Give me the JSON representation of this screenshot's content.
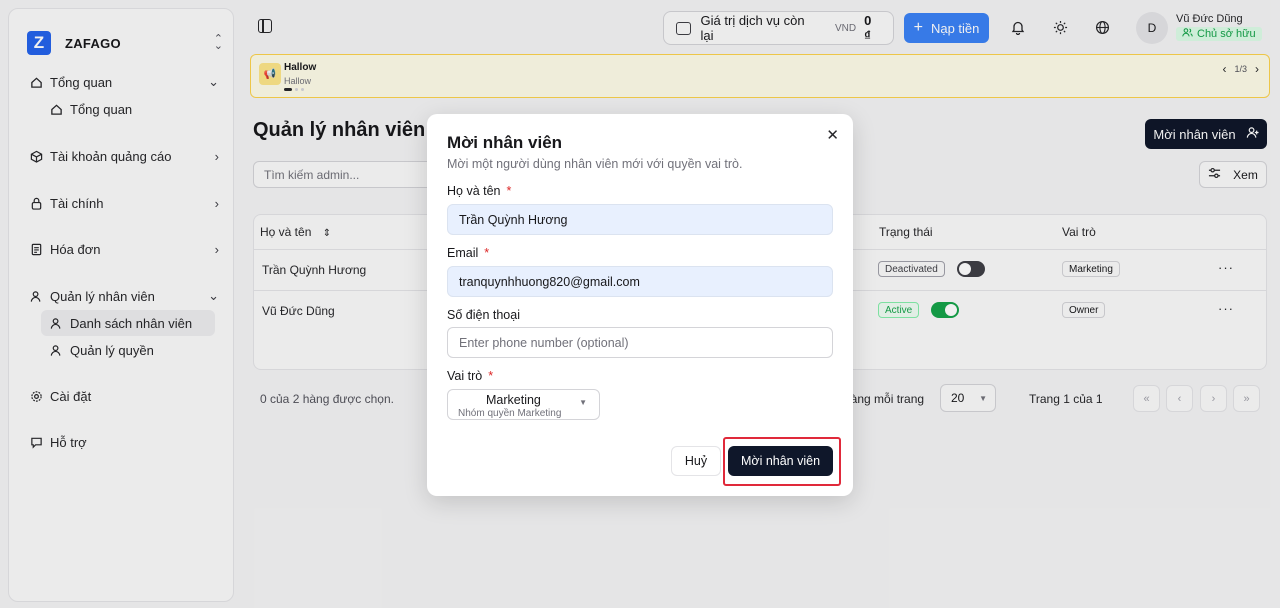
{
  "brand": {
    "logo_letter": "Z",
    "name": "ZAFAGO"
  },
  "sidebar": {
    "items": [
      {
        "label": "Tổng quan",
        "icon": "home-icon"
      },
      {
        "label": "Tổng quan",
        "icon": "home-icon",
        "sub": true
      },
      {
        "label": "Tài khoản quảng cáo",
        "icon": "cube-icon"
      },
      {
        "label": "Tài chính",
        "icon": "lock-icon"
      },
      {
        "label": "Hóa đơn",
        "icon": "file-icon"
      },
      {
        "label": "Quản lý nhân viên",
        "icon": "user-icon"
      },
      {
        "label": "Danh sách nhân viên",
        "icon": "user-icon",
        "sub": true,
        "active": true
      },
      {
        "label": "Quản lý quyền",
        "icon": "user-icon",
        "sub": true
      },
      {
        "label": "Cài đặt",
        "icon": "gear-icon"
      },
      {
        "label": "Hỗ trợ",
        "icon": "chat-icon"
      }
    ]
  },
  "topbar": {
    "balance_label": "Giá trị dịch vụ còn lại",
    "currency": "VND",
    "balance_amount": "0 ₫",
    "topup_label": "Nạp tiền",
    "avatar_letter": "D",
    "user_name": "Vũ Đức Dũng",
    "user_role": "Chủ sở hữu"
  },
  "announcement": {
    "title": "Hallow",
    "body": "Hallow",
    "pager": "1/3"
  },
  "main": {
    "title": "Quản lý nhân viên",
    "invite_label": "Mời nhân viên",
    "search_placeholder": "Tìm kiếm admin...",
    "view_label": "Xem",
    "columns": {
      "name": "Họ và tên",
      "status": "Trạng thái",
      "role": "Vai trò"
    },
    "rows": [
      {
        "name": "Trần Quỳnh Hương",
        "status": "Deactivated",
        "active": false,
        "role": "Marketing"
      },
      {
        "name": "Vũ Đức Dũng",
        "status": "Active",
        "active": true,
        "role": "Owner"
      }
    ],
    "selected_text": "0 của 2 hàng được chọn.",
    "rows_per_page_label": "Hàng mỗi trang",
    "rows_per_page": "20",
    "page_info": "Trang 1 của 1"
  },
  "modal": {
    "title": "Mời nhân viên",
    "description": "Mời một người dùng nhân viên mới với quyền vai trò.",
    "name_label": "Họ và tên",
    "name_value": "Trần Quỳnh Hương",
    "email_label": "Email",
    "email_value": "tranquynhhuong820@gmail.com",
    "phone_label": "Số điện thoại",
    "phone_placeholder": "Enter phone number (optional)",
    "role_label": "Vai trò",
    "role_value": "Marketing",
    "role_sub": "Nhóm quyền Marketing",
    "required_mark": "*",
    "cancel_label": "Huỷ",
    "submit_label": "Mời nhân viên"
  },
  "colors": {
    "primary": "#0f172a",
    "accent": "#3b82f6",
    "success": "#16a34a",
    "danger": "#e0293a"
  }
}
